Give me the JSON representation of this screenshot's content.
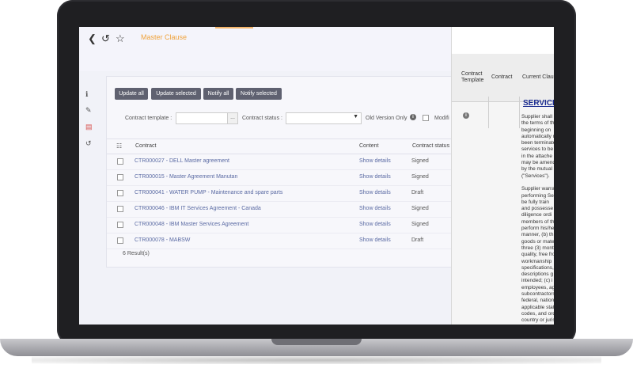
{
  "app": {
    "page_title": "Master Clause"
  },
  "nav": {
    "back_icon": "chevron-left-icon",
    "history_icon": "history-icon",
    "favorite_icon": "star-icon"
  },
  "sidebar": {
    "items": [
      {
        "icon": "info-icon",
        "glyph": "ℹ"
      },
      {
        "icon": "edit-icon",
        "glyph": "✎"
      },
      {
        "icon": "pdf-file-icon",
        "glyph": "▤"
      },
      {
        "icon": "undo-icon",
        "glyph": "↺"
      }
    ]
  },
  "toolbar": {
    "update_all": "Update all",
    "update_selected": "Update selected",
    "notify_all": "Notify all",
    "notify_selected": "Notify selected"
  },
  "filters": {
    "contract_template_label": "Contract template :",
    "contract_template_value": "",
    "ellipsis": "...",
    "contract_status_label": "Contract status :",
    "contract_status_value": "",
    "old_version_label": "Old Version Only",
    "modified_label": "Modifi"
  },
  "table": {
    "columns": [
      "Contract",
      "Content",
      "Contract status"
    ],
    "rows": [
      {
        "contract": "CTR000027 - DELL Master agreement",
        "content": "Show details",
        "status": "Signed"
      },
      {
        "contract": "CTR000015 - Master Agreement Manutan",
        "content": "Show details",
        "status": "Signed"
      },
      {
        "contract": "CTR000041 - WATER PUMP - Maintenance and spare parts",
        "content": "Show details",
        "status": "Draft"
      },
      {
        "contract": "CTR000046 - IBM IT Services Agreement - Canada",
        "content": "Show details",
        "status": "Signed"
      },
      {
        "contract": "CTR000048 - IBM Master Services Agreement",
        "content": "Show details",
        "status": "Signed"
      },
      {
        "contract": "CTR000078 - MABSW",
        "content": "Show details",
        "status": "Draft"
      }
    ],
    "results": "6 Result(s)"
  },
  "details_panel": {
    "col_contract_template": "Contract\nTemplate",
    "col_contract": "Contract",
    "col_current_clause": "Current Clau",
    "services_heading": "SERVICE",
    "clause_text": "Supplier shall\nthe terms of th\nbeginning on\nautomatically r\nbeen terminate\nservices to be\nin the attache\nmay be amend\nby the mutual\n(\"Services\").\n\nSupplier warra\nperforming Se\nbe fully train\nand possesse\ndiligence ordi\nmembers of th\nperform his/he\nmanner, (b) th\ngoods or mate\nthree (3) mont\nquality, free fro\nworkmanship\nspecifications,\ndescriptions g\nintended; (c) i\nemployees, ag\nsubcontractors\nfederal, nation\napplicable stat\ncodes, and ord\ncountry or juris\nincluding, with\nand Privacy L"
  }
}
